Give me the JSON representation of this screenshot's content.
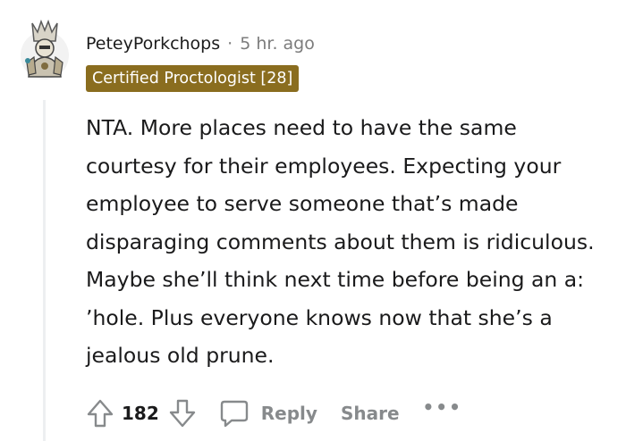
{
  "comment": {
    "author": "PeteyPorkchops",
    "separator": "·",
    "timestamp": "5 hr. ago",
    "flair": "Certified Proctologist [28]",
    "flair_color": "#8a6d1f",
    "body": "NTA. More places need to have the same courtesy for their employees. Expecting your employee to serve someone that’s made disparaging comments about them is ridiculous. Maybe she’ll think next time before being an a: ʼhole. Plus everyone knows now that she’s a jealous old prune.",
    "avatar_icon": "user-avatar-armored-figure"
  },
  "actions": {
    "upvote_icon": "arrow-up-icon",
    "score": "182",
    "downvote_icon": "arrow-down-icon",
    "reply_icon": "speech-bubble-icon",
    "reply_label": "Reply",
    "share_label": "Share",
    "more_label": "•••"
  },
  "colors": {
    "text": "#1a1a1b",
    "muted": "#7c7c7c",
    "action_gray": "#878a8c",
    "thread_line": "#edeff1"
  }
}
